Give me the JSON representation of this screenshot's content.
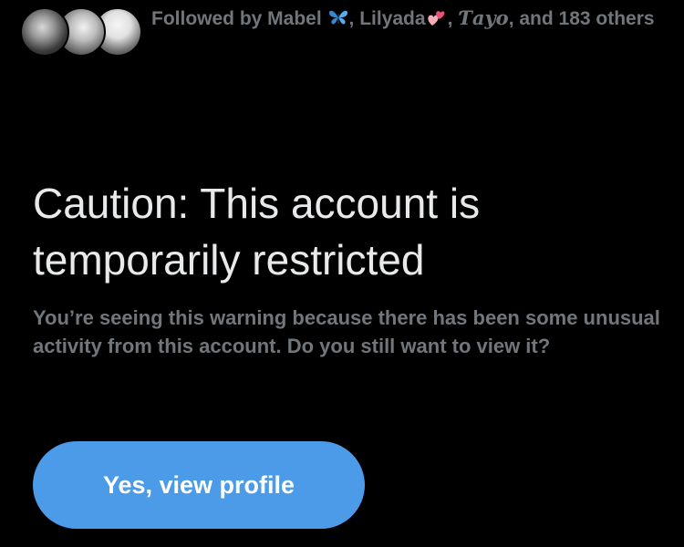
{
  "followers": {
    "prefix": "Followed by Mabel ",
    "name2": ", Lilyada",
    "name3_sep": ", ",
    "name3": "Ƭayo",
    "suffix": ", and 183 others",
    "emoji_butterfly": "butterfly-emoji",
    "emoji_hearts": "two-hearts-emoji"
  },
  "warning": {
    "title": "Caution: This account is temporarily restricted",
    "body": "You’re seeing this warning because there has been some unusual activity from this account. Do you still want to view it?"
  },
  "actions": {
    "view_profile_label": "Yes, view profile"
  },
  "colors": {
    "background": "#000000",
    "primary_text": "#e7e9ea",
    "secondary_text": "#71767b",
    "button_bg": "#4c9be8",
    "button_text": "#ffffff"
  }
}
